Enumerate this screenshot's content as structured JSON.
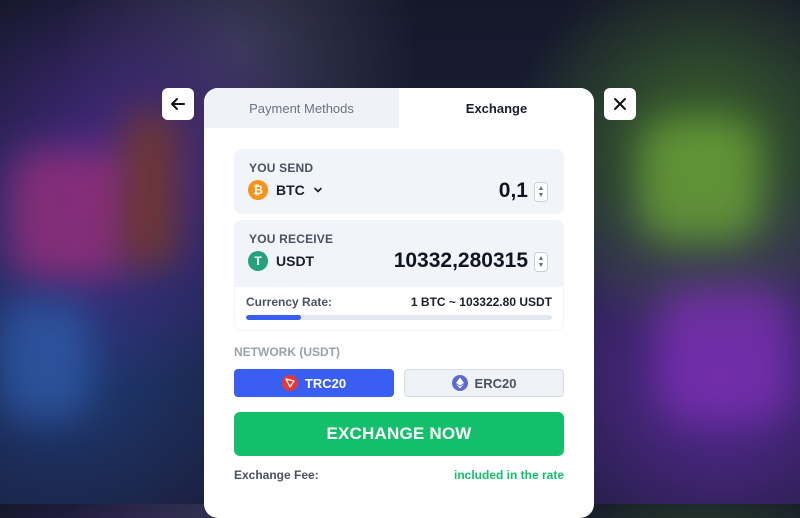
{
  "tabs": [
    {
      "label": "Payment Methods",
      "active": false
    },
    {
      "label": "Exchange",
      "active": true
    }
  ],
  "send": {
    "label": "YOU SEND",
    "currency": "BTC",
    "coin_symbol": "₿",
    "amount": "0,1"
  },
  "receive": {
    "label": "YOU RECEIVE",
    "currency": "USDT",
    "coin_symbol": "T",
    "amount": "10332,280315"
  },
  "rate": {
    "label": "Currency Rate:",
    "value": "1 BTC ~ 103322.80 USDT",
    "progress_percent": 18
  },
  "network": {
    "label": "NETWORK (USDT)",
    "options": [
      {
        "label": "TRC20",
        "selected": true
      },
      {
        "label": "ERC20",
        "selected": false
      }
    ]
  },
  "exchange_button": "EXCHANGE NOW",
  "fee": {
    "label": "Exchange Fee:",
    "value": "included in the rate"
  },
  "colors": {
    "accent_blue": "#3b5ef2",
    "accent_green": "#14bf6b",
    "btc_orange": "#f7931a",
    "usdt_green": "#26a17b"
  },
  "icons": {
    "back": "arrow-left-icon",
    "close": "close-icon",
    "dropdown": "chevron-down-icon",
    "trc": "tron-icon",
    "erc": "ethereum-icon"
  }
}
